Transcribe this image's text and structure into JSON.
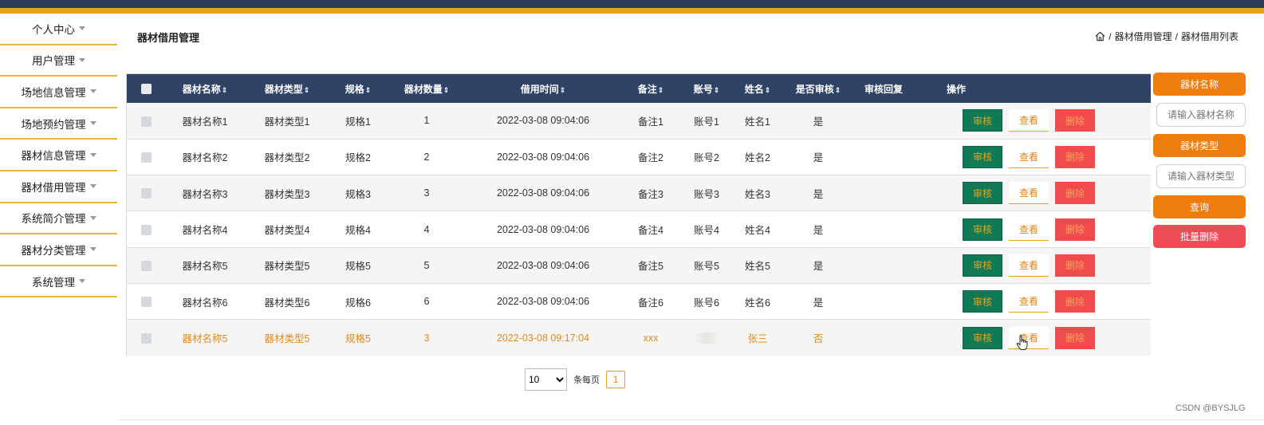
{
  "sidebar": {
    "items": [
      {
        "label": "个人中心"
      },
      {
        "label": "用户管理"
      },
      {
        "label": "场地信息管理"
      },
      {
        "label": "场地预约管理"
      },
      {
        "label": "器材信息管理"
      },
      {
        "label": "器材借用管理"
      },
      {
        "label": "系统简介管理"
      },
      {
        "label": "器材分类管理"
      },
      {
        "label": "系统管理"
      }
    ]
  },
  "header": {
    "title": "器材借用管理",
    "breadcrumb": [
      "器材借用管理",
      "器材借用列表"
    ],
    "breadcrumb_sep": "/"
  },
  "table": {
    "columns": [
      "器材名称",
      "器材类型",
      "规格",
      "器材数量",
      "借用时间",
      "备注",
      "账号",
      "姓名",
      "是否审核",
      "审核回复",
      "操作"
    ],
    "sort_glyph": "⇕",
    "rows": [
      {
        "name": "器材名称1",
        "type": "器材类型1",
        "spec": "规格1",
        "qty": "1",
        "time": "2022-03-08 09:04:06",
        "note": "备注1",
        "account": "账号1",
        "person": "姓名1",
        "approved": "是",
        "reply": ""
      },
      {
        "name": "器材名称2",
        "type": "器材类型2",
        "spec": "规格2",
        "qty": "2",
        "time": "2022-03-08 09:04:06",
        "note": "备注2",
        "account": "账号2",
        "person": "姓名2",
        "approved": "是",
        "reply": ""
      },
      {
        "name": "器材名称3",
        "type": "器材类型3",
        "spec": "规格3",
        "qty": "3",
        "time": "2022-03-08 09:04:06",
        "note": "备注3",
        "account": "账号3",
        "person": "姓名3",
        "approved": "是",
        "reply": ""
      },
      {
        "name": "器材名称4",
        "type": "器材类型4",
        "spec": "规格4",
        "qty": "4",
        "time": "2022-03-08 09:04:06",
        "note": "备注4",
        "account": "账号4",
        "person": "姓名4",
        "approved": "是",
        "reply": ""
      },
      {
        "name": "器材名称5",
        "type": "器材类型5",
        "spec": "规格5",
        "qty": "5",
        "time": "2022-03-08 09:04:06",
        "note": "备注5",
        "account": "账号5",
        "person": "姓名5",
        "approved": "是",
        "reply": ""
      },
      {
        "name": "器材名称6",
        "type": "器材类型6",
        "spec": "规格6",
        "qty": "6",
        "time": "2022-03-08 09:04:06",
        "note": "备注6",
        "account": "账号6",
        "person": "姓名6",
        "approved": "是",
        "reply": ""
      },
      {
        "name": "器材名称5",
        "type": "器材类型5",
        "spec": "规格5",
        "qty": "3",
        "time": "2022-03-08 09:17:04",
        "note": "xxx",
        "account": "",
        "person": "张三",
        "approved": "否",
        "reply": "",
        "highlight": true
      }
    ],
    "actions": {
      "review": "审核",
      "view": "查看",
      "delete": "删除"
    }
  },
  "search": {
    "name_label": "器材名称",
    "name_placeholder": "请输入器材名称",
    "type_label": "器材类型",
    "type_placeholder": "请输入器材类型",
    "query_button": "查询",
    "batch_delete_button": "批量删除"
  },
  "pager": {
    "page_size": "10",
    "per_page_label": "条每页",
    "current_page": "1"
  },
  "watermark": "CSDN @BYSJLG",
  "colors": {
    "nav_dark": "#2c3e5c",
    "accent_gold": "#e8a21a",
    "accent_orange": "#ee7d0c",
    "review_green": "#117a55",
    "delete_red": "#f04c4c"
  }
}
